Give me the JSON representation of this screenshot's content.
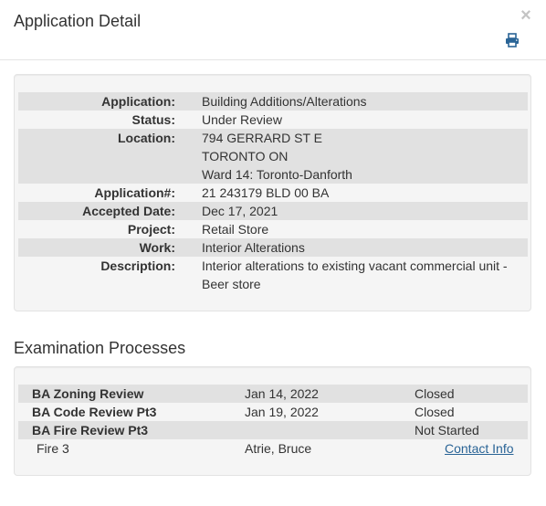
{
  "header": {
    "title": "Application Detail",
    "close_symbol": "×",
    "print_icon": "printer-icon"
  },
  "details": [
    {
      "label": "Application:",
      "value": [
        "Building Additions/Alterations"
      ]
    },
    {
      "label": "Status:",
      "value": [
        "Under Review"
      ]
    },
    {
      "label": "Location:",
      "value": [
        "794 GERRARD ST E",
        "TORONTO ON",
        "Ward 14: Toronto-Danforth"
      ]
    },
    {
      "label": "Application#:",
      "value": [
        "21 243179 BLD 00 BA"
      ]
    },
    {
      "label": "Accepted Date:",
      "value": [
        "Dec 17, 2021"
      ]
    },
    {
      "label": "Project:",
      "value": [
        "Retail Store"
      ]
    },
    {
      "label": "Work:",
      "value": [
        "Interior Alterations"
      ]
    },
    {
      "label": "Description:",
      "value": [
        "Interior alterations to existing vacant commercial unit -",
        "Beer store"
      ]
    }
  ],
  "examination": {
    "title": "Examination Processes",
    "processes": [
      {
        "name": "BA Zoning Review",
        "date": "Jan 14, 2022",
        "status": "Closed"
      },
      {
        "name": "BA Code Review Pt3",
        "date": "Jan 19, 2022",
        "status": "Closed"
      },
      {
        "name": "BA Fire Review Pt3",
        "date": "",
        "status": "Not Started"
      }
    ],
    "sub_row": {
      "name": "Fire 3",
      "person": "Atrie, Bruce",
      "link": "Contact Info"
    }
  },
  "colors": {
    "stripe": "#e1e1e1",
    "well_bg": "#f5f5f5",
    "link": "#2a6496",
    "print_icon": "#2a6496"
  }
}
